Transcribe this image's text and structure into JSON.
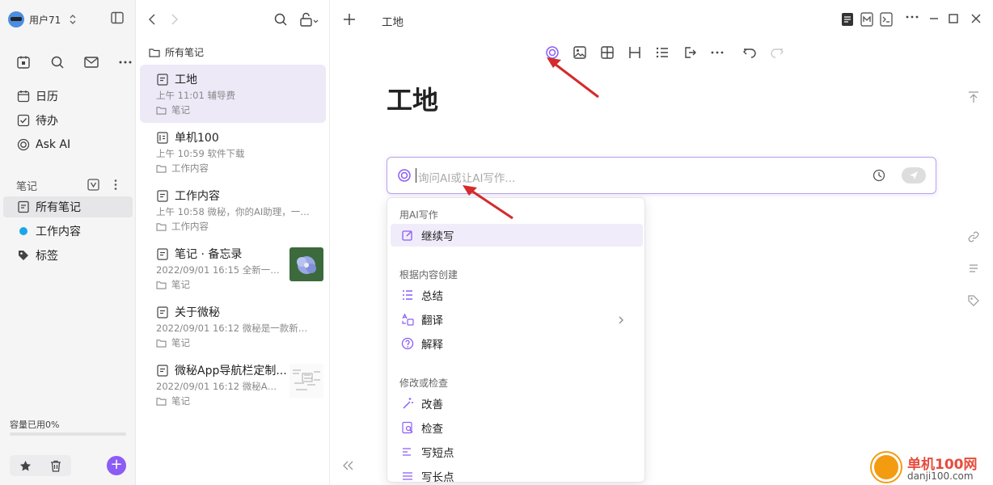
{
  "sidebar": {
    "user_name": "用户71",
    "quick_icons": [
      "calendar-day-icon",
      "search-icon",
      "mail-icon",
      "more-icon"
    ],
    "nav": [
      {
        "label": "日历",
        "icon": "calendar-icon"
      },
      {
        "label": "待办",
        "icon": "checkbox-icon"
      },
      {
        "label": "Ask AI",
        "icon": "ai-icon"
      }
    ],
    "notes_section": "笔记",
    "folders": [
      {
        "label": "所有笔记",
        "icon": "note-icon",
        "active": true
      },
      {
        "label": "工作内容",
        "icon": "blue-dot-icon"
      },
      {
        "label": "标签",
        "icon": "tag-icon"
      }
    ],
    "storage_text": "容量已用0%",
    "storage_percent": 0
  },
  "list": {
    "header": "所有笔记",
    "notes": [
      {
        "title": "工地",
        "meta": "上午 11:01  辅导费",
        "folder": "笔记",
        "active": true
      },
      {
        "title": "单机100",
        "meta": "上午 10:59  软件下载",
        "folder": "工作内容"
      },
      {
        "title": "工作内容",
        "meta": "上午 10:58  微秘，你的AI助理，一站...",
        "folder": "工作内容"
      },
      {
        "title": "笔记 · 备忘录",
        "meta": "2022/09/01 16:15  全新一代...",
        "folder": "笔记",
        "thumb": "flower"
      },
      {
        "title": "关于微秘",
        "meta": "2022/09/01 16:12  微秘是一款新型...",
        "folder": "笔记"
      },
      {
        "title": "微秘App导航栏定制...",
        "meta": "2022/09/01 16:12  微秘App...",
        "folder": "笔记",
        "thumb": "doc"
      }
    ]
  },
  "editor": {
    "tab_title": "工地",
    "doc_title": "工地",
    "ai_placeholder": "询问AI或让AI写作...",
    "menu": {
      "sections": [
        {
          "title": "用AI写作",
          "items": [
            {
              "label": "继续写",
              "icon": "edit-icon",
              "active": true
            }
          ]
        },
        {
          "title": "根据内容创建",
          "items": [
            {
              "label": "总结",
              "icon": "list-icon"
            },
            {
              "label": "翻译",
              "icon": "translate-icon",
              "submenu": true
            },
            {
              "label": "解释",
              "icon": "question-icon"
            }
          ]
        },
        {
          "title": "修改或检查",
          "items": [
            {
              "label": "改善",
              "icon": "magic-wand-icon"
            },
            {
              "label": "检查",
              "icon": "check-doc-icon"
            },
            {
              "label": "写短点",
              "icon": "short-lines-icon"
            },
            {
              "label": "写长点",
              "icon": "long-lines-icon"
            }
          ]
        }
      ]
    }
  },
  "watermark": {
    "name": "单机100网",
    "url": "danji100.com"
  },
  "colors": {
    "accent": "#8b5cf6",
    "active_note_bg": "#ede9f7",
    "sidebar_bg": "#f5f5f6",
    "arrow": "#d42b2b"
  }
}
